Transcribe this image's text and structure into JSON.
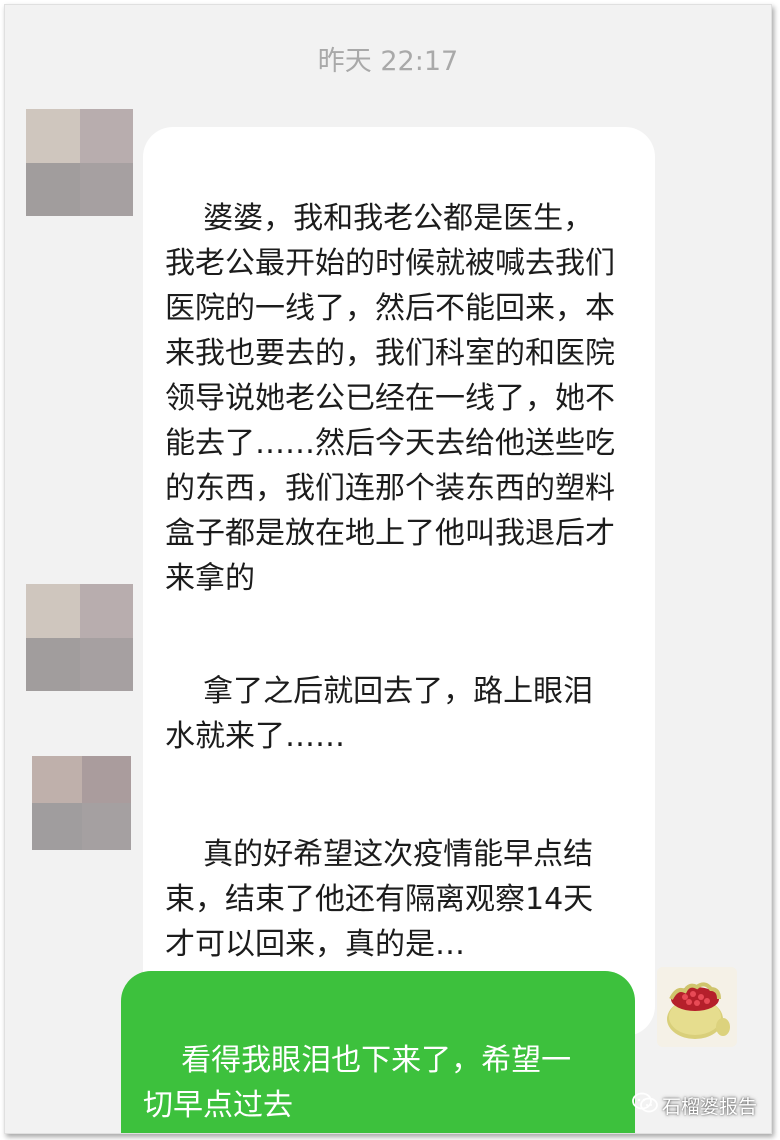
{
  "header": {
    "timestamp": "昨天 22:17"
  },
  "messages": [
    {
      "text": "婆婆，我和我老公都是医生，我老公最开始的时候就被喊去我们医院的一线了，然后不能回来，本来我也要去的，我们科室的和医院领导说她老公已经在一线了，她不能去了……然后今天去给他送些吃的东西，我们连那个装东西的塑料盒子都是放在地上了他叫我退后才来拿的"
    },
    {
      "text": "拿了之后就回去了，路上眼泪水就来了……"
    },
    {
      "text": "真的好希望这次疫情能早点结束，结束了他还有隔离观察14天才可以回来，真的是…"
    },
    {
      "text": "看得我眼泪也下来了，希望一切早点过去"
    }
  ],
  "watermark": {
    "text": "石榴婆报告"
  },
  "colors": {
    "outgoing_bubble": "#3dc13d",
    "incoming_bubble": "#ffffff",
    "background": "#f2f2f2"
  },
  "icons": {
    "avatar_self": "pomegranate-avatar-icon",
    "watermark": "wechat-logo-icon"
  }
}
